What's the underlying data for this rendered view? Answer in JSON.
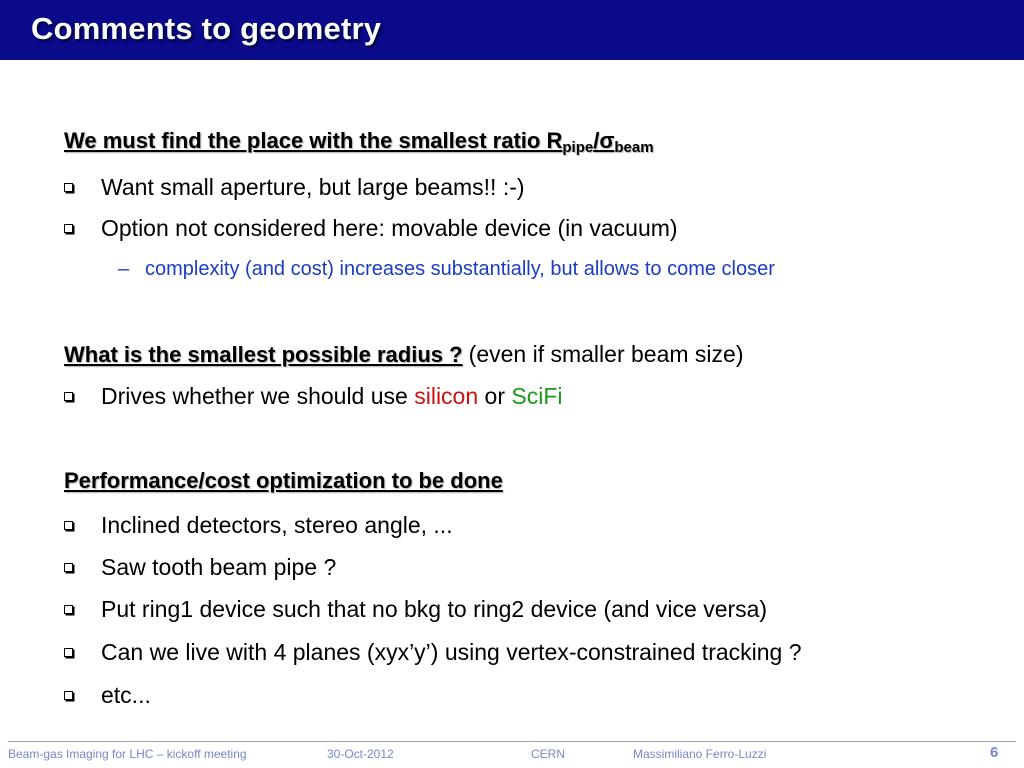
{
  "slide": {
    "title": "Comments to geometry",
    "section1": {
      "heading_prefix": "We must find the place with the smallest ratio R",
      "heading_sub1": "pipe",
      "heading_slash": "/",
      "heading_sigma": "σ",
      "heading_sub2": "beam",
      "bullets": [
        "Want small aperture, but large beams!!  :-)",
        "Option not considered here: movable device (in vacuum)"
      ],
      "sub_dash": "–",
      "sub_bullet": "complexity (and cost) increases substantially, but allows to come closer"
    },
    "section2": {
      "heading": "What is the smallest possible radius ?",
      "heading_suffix": "(even if smaller beam size)",
      "bullet_prefix": "Drives whether we should use ",
      "bullet_silicon": "silicon",
      "bullet_or": " or ",
      "bullet_scifi": "SciFi"
    },
    "section3": {
      "heading": "Performance/cost optimization to be done",
      "bullets": [
        "Inclined detectors, stereo angle, ...",
        "Saw tooth beam pipe ?",
        "Put ring1 device such that no bkg to ring2 device (and vice versa)",
        "Can we live with 4 planes (xyx’y’) using vertex-constrained tracking ?",
        "etc..."
      ]
    },
    "footer": {
      "event": "Beam-gas Imaging for LHC – kickoff meeting",
      "date": "30-Oct-2012",
      "org": "CERN",
      "author": "Massimiliano Ferro-Luzzi",
      "page": "6"
    },
    "colors": {
      "title_bar": "#0a0a8a",
      "sub_bullet": "#1a3cc8",
      "silicon": "#cc1111",
      "scifi": "#1a9a1a",
      "footer": "#7a86c8"
    }
  }
}
